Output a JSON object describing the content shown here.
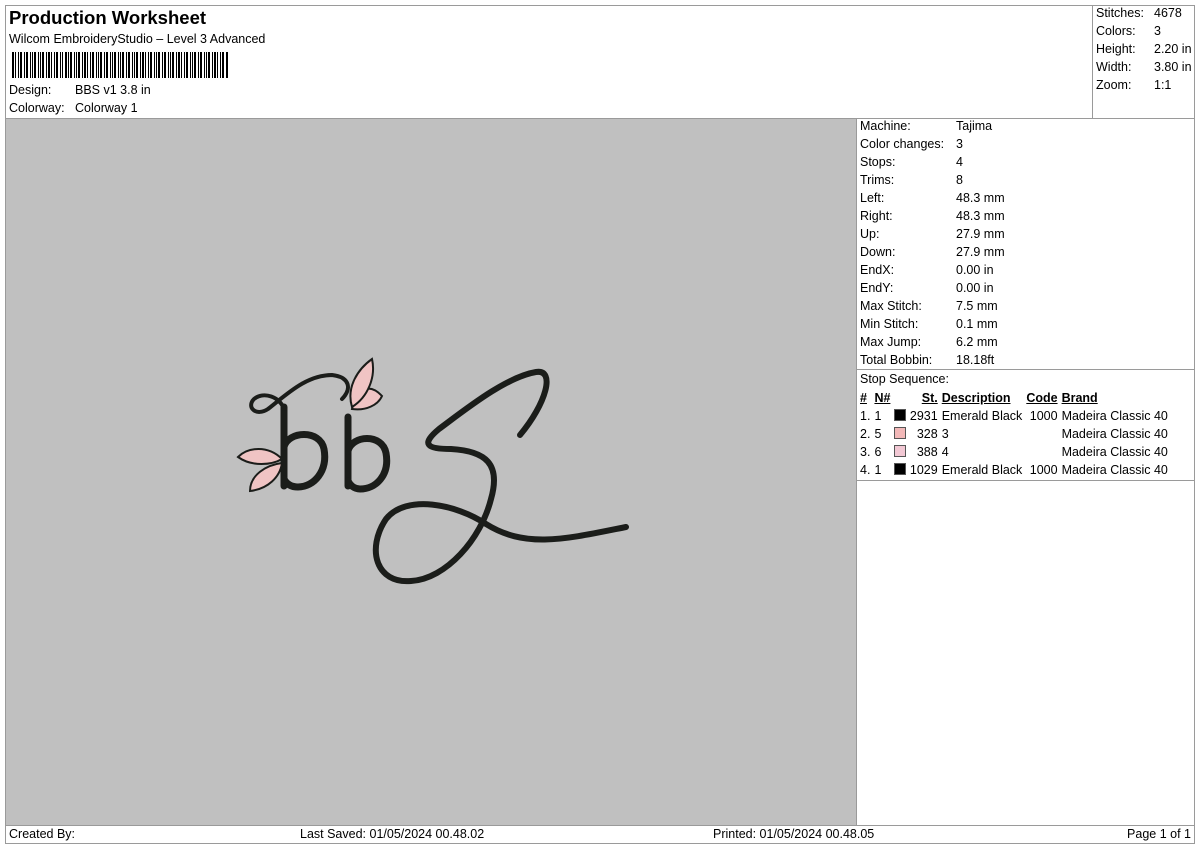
{
  "header": {
    "title": "Production Worksheet",
    "subtitle": "Wilcom EmbroideryStudio – Level 3 Advanced",
    "design_label": "Design:",
    "design_value": "BBS v1 3.8 in",
    "colorway_label": "Colorway:",
    "colorway_value": "Colorway 1"
  },
  "summary": [
    {
      "label": "Stitches:",
      "value": "4678"
    },
    {
      "label": "Colors:",
      "value": "3"
    },
    {
      "label": "Height:",
      "value": "2.20 in"
    },
    {
      "label": "Width:",
      "value": "3.80 in"
    },
    {
      "label": "Zoom:",
      "value": "1:1"
    }
  ],
  "machine": [
    {
      "label": "Machine:",
      "value": "Tajima"
    },
    {
      "label": "Color changes:",
      "value": "3"
    },
    {
      "label": "Stops:",
      "value": "4"
    },
    {
      "label": "Trims:",
      "value": "8"
    },
    {
      "label": "Left:",
      "value": "48.3 mm"
    },
    {
      "label": "Right:",
      "value": "48.3 mm"
    },
    {
      "label": "Up:",
      "value": "27.9 mm"
    },
    {
      "label": "Down:",
      "value": "27.9 mm"
    },
    {
      "label": "EndX:",
      "value": "0.00 in"
    },
    {
      "label": "EndY:",
      "value": "0.00 in"
    },
    {
      "label": "Max Stitch:",
      "value": "7.5 mm"
    },
    {
      "label": "Min Stitch:",
      "value": "0.1 mm"
    },
    {
      "label": "Max Jump:",
      "value": "6.2 mm"
    },
    {
      "label": "Total Bobbin:",
      "value": "18.18ft"
    }
  ],
  "stop_sequence": {
    "heading": "Stop Sequence:",
    "columns": {
      "num": "#",
      "n": "N#",
      "st": "St.",
      "description": "Description",
      "code": "Code",
      "brand": "Brand"
    },
    "rows": [
      {
        "num": "1.",
        "n": "1",
        "color": "#000000",
        "st": "2931",
        "description": "Emerald Black",
        "code": "1000",
        "brand": "Madeira Classic 40"
      },
      {
        "num": "2.",
        "n": "5",
        "color": "#f2b8b8",
        "st": "328",
        "description": "3",
        "code": "",
        "brand": "Madeira Classic 40"
      },
      {
        "num": "3.",
        "n": "6",
        "color": "#f2c8d4",
        "st": "388",
        "description": "4",
        "code": "",
        "brand": "Madeira Classic 40"
      },
      {
        "num": "4.",
        "n": "1",
        "color": "#000000",
        "st": "1029",
        "description": "Emerald Black",
        "code": "1000",
        "brand": "Madeira Classic 40"
      }
    ]
  },
  "footer": {
    "created_by": "Created By:",
    "last_saved": "Last Saved: 01/05/2024 00.48.02",
    "printed": "Printed: 01/05/2024 00.48.05",
    "page": "Page 1 of 1"
  },
  "design_colors": {
    "thread_dark": "#1b1d1a",
    "petal": "#f0c4c4",
    "background": "#c0c0c0"
  }
}
